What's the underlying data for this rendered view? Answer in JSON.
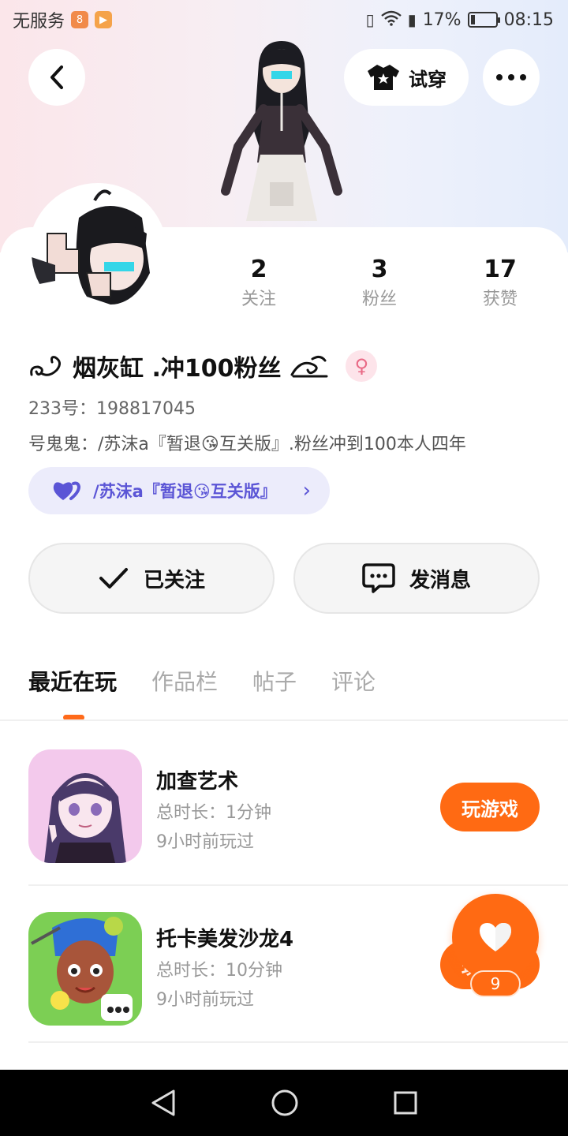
{
  "status_bar": {
    "carrier": "无服务",
    "battery_percent": "17%",
    "battery_level": 0.17,
    "time": "08:15"
  },
  "header": {
    "tryon_label": "试穿"
  },
  "profile": {
    "stats": [
      {
        "value": "2",
        "label": "关注"
      },
      {
        "value": "3",
        "label": "粉丝"
      },
      {
        "value": "17",
        "label": "获赞"
      }
    ],
    "nickname": "烟灰缸 .冲100粉丝",
    "nickname_prefix_deco": "ᕦ",
    "user_id": "233号：198817045",
    "bio": "号鬼鬼：/苏沫a『暂退😘互关版』.粉丝冲到100本人四年",
    "relation_label": "/苏沫a『暂退😘互关版』"
  },
  "actions": {
    "follow_label": "已关注",
    "message_label": "发消息"
  },
  "tabs": [
    "最近在玩",
    "作品栏",
    "帖子",
    "评论"
  ],
  "games": [
    {
      "title": "加查艺术",
      "duration": "总时长：1分钟",
      "last_played": "9小时前玩过",
      "play_label": "玩游戏"
    },
    {
      "title": "托卡美发沙龙4",
      "duration": "总时长：10分钟",
      "last_played": "9小时前玩过",
      "play_label": "玩游戏"
    }
  ],
  "like_count": "9",
  "colors": {
    "accent": "#ff6a13",
    "relation_text": "#5b55d6",
    "relation_bg": "#ececfb"
  }
}
